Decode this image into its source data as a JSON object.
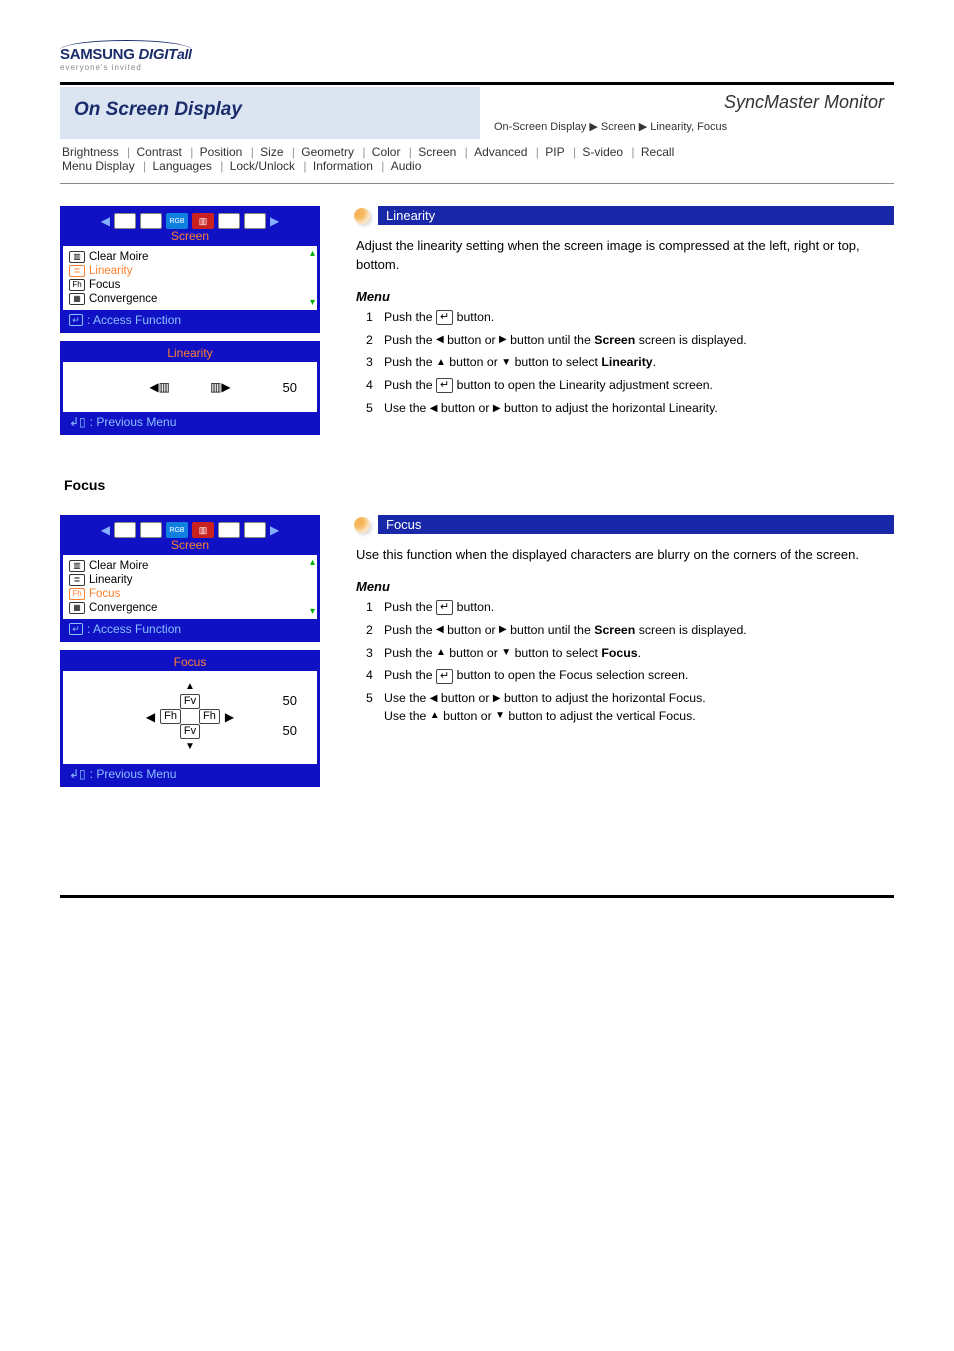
{
  "logo": {
    "brand_plain": "SAMSUNG",
    "brand_italic": " DIGIT",
    "brand_tail": "all",
    "tagline": "everyone's invited"
  },
  "product_line": "SyncMaster Monitor",
  "page_title": "On Screen Display",
  "breadcrumb": "On-Screen Display ▶ Screen ▶ Linearity, Focus",
  "toc": {
    "items": [
      "Brightness",
      "Contrast",
      "Position",
      "Size",
      "Geometry",
      "Color",
      "Screen",
      "Advanced",
      "PIP",
      "S-video",
      "Recall",
      "Menu Display",
      "Languages",
      "Lock/Unlock",
      "Information",
      "Audio"
    ],
    "sep": " | "
  },
  "osd_common": {
    "tab_title": "Screen",
    "items": [
      "Clear Moire",
      "Linearity",
      "Focus",
      "Convergence"
    ],
    "access_label": ": Access Function",
    "previous_label": " : Previous Menu"
  },
  "sect1": {
    "osd_sel_idx": 1,
    "value_title": "Linearity",
    "value_num": "50",
    "r_title": "Linearity",
    "r_desc": "Adjust the linearity setting when the screen image is compressed at the left, right or top, bottom.",
    "menu_heading": "Menu",
    "steps": [
      "Push the      button.",
      "Push the   ◀  button or   ▶  button until the Screen screen is displayed.",
      "Push the   ▲  button or   ▼  button to select Linearity.",
      "Push the      button to open the Linearity adjustment screen.",
      "Use the   ◀  button or   ▶  button to adjust the horizontal Linearity."
    ],
    "footer_title": "Focus"
  },
  "sect2": {
    "osd_sel_idx": 2,
    "value_title": "Focus",
    "value_num1": "50",
    "value_num2": "50",
    "r_title": "Focus",
    "r_desc": "Use this function when the displayed characters are blurry on the corners of the screen.",
    "menu_heading": "Menu",
    "steps": [
      "Push the      button.",
      "Push the   ◀  button or   ▶  button until the Screen screen is displayed.",
      "Push the   ▲  button or   ▼  button to select Focus.",
      "Push the      button to open the Focus selection screen.",
      "Use the   ◀  button or   ▶  button to adjust the horizontal Focus.",
      "Use the   ▲  button or   ▼  button to adjust the vertical Focus."
    ]
  },
  "chart_data": {
    "type": "table",
    "title": "OSD adjustment values shown",
    "rows": [
      {
        "setting": "Linearity",
        "value": 50
      },
      {
        "setting": "Focus (Fh)",
        "value": 50
      },
      {
        "setting": "Focus (Fv)",
        "value": 50
      }
    ]
  }
}
